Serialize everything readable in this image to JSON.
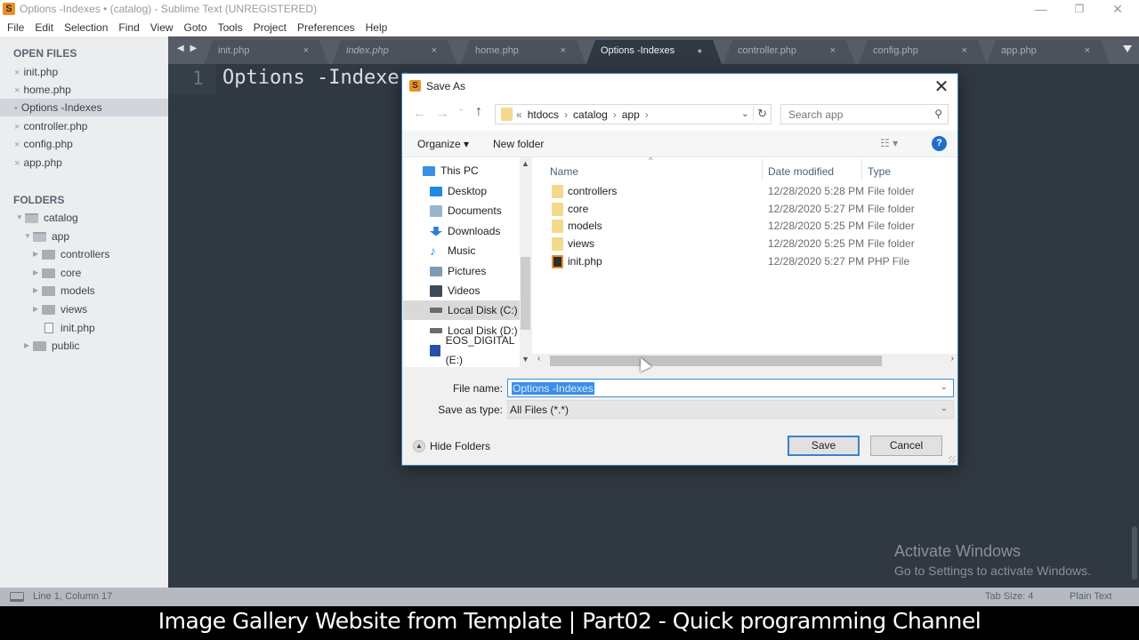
{
  "window": {
    "title": "Options -Indexes • (catalog) - Sublime Text (UNREGISTERED)",
    "controls": {
      "minimize": "—",
      "restore": "❐",
      "close": "✕"
    }
  },
  "menu": [
    "File",
    "Edit",
    "Selection",
    "Find",
    "View",
    "Goto",
    "Tools",
    "Project",
    "Preferences",
    "Help"
  ],
  "sidebar": {
    "open_files_title": "OPEN FILES",
    "open_files": [
      {
        "label": "init.php",
        "marker": "×",
        "active": false
      },
      {
        "label": "home.php",
        "marker": "×",
        "active": false
      },
      {
        "label": "Options -Indexes",
        "marker": "•",
        "active": true
      },
      {
        "label": "controller.php",
        "marker": "×",
        "active": false
      },
      {
        "label": "config.php",
        "marker": "×",
        "active": false
      },
      {
        "label": "app.php",
        "marker": "×",
        "active": false
      }
    ],
    "folders_title": "FOLDERS",
    "tree": [
      {
        "label": "catalog",
        "type": "folder-open",
        "depth": 0
      },
      {
        "label": "app",
        "type": "folder-open",
        "depth": 1
      },
      {
        "label": "controllers",
        "type": "folder",
        "depth": 2
      },
      {
        "label": "core",
        "type": "folder",
        "depth": 2
      },
      {
        "label": "models",
        "type": "folder",
        "depth": 2
      },
      {
        "label": "views",
        "type": "folder",
        "depth": 2
      },
      {
        "label": "init.php",
        "type": "file",
        "depth": 2
      },
      {
        "label": "public",
        "type": "folder",
        "depth": 1
      }
    ]
  },
  "tabs": [
    {
      "label": "init.php",
      "close": "×",
      "active": false,
      "italic": false
    },
    {
      "label": "index.php",
      "close": "×",
      "active": false,
      "italic": true
    },
    {
      "label": "home.php",
      "close": "×",
      "active": false,
      "italic": false
    },
    {
      "label": "Options -Indexes",
      "close": "●",
      "active": true,
      "italic": false
    },
    {
      "label": "controller.php",
      "close": "×",
      "active": false,
      "italic": false
    },
    {
      "label": "config.php",
      "close": "×",
      "active": false,
      "italic": false
    },
    {
      "label": "app.php",
      "close": "×",
      "active": false,
      "italic": false
    }
  ],
  "tab_nav": "◀ ▶",
  "editor": {
    "line_number": "1",
    "code": "Options -Indexes"
  },
  "watermark": {
    "line1": "Activate Windows",
    "line2": "Go to Settings to activate Windows."
  },
  "statusbar": {
    "position": "Line 1, Column 17",
    "tab_size": "Tab Size: 4",
    "syntax": "Plain Text"
  },
  "caption": "Image Gallery Website from Template | Part02 - Quick programming Channel",
  "dialog": {
    "title": "Save As",
    "close": "✕",
    "nav": {
      "back": "←",
      "forward": "→",
      "recent": "⌄",
      "up": "↑"
    },
    "breadcrumb": [
      "«",
      "htdocs",
      "›",
      "catalog",
      "›",
      "app",
      "›"
    ],
    "address_dropdown": "⌄",
    "refresh": "↻",
    "search_placeholder": "Search app",
    "search_icon": "⚲",
    "toolbar": {
      "organize": "Organize ▾",
      "new_folder": "New folder",
      "views": "☷ ▾",
      "help": "?"
    },
    "nav_pane": [
      {
        "label": "This PC",
        "icon": "computer-icon",
        "color": "#3a8ee6",
        "selected": false,
        "indent": 0
      },
      {
        "label": "Desktop",
        "icon": "desktop-icon",
        "color": "#1e88e5",
        "selected": false,
        "indent": 1
      },
      {
        "label": "Documents",
        "icon": "documents-icon",
        "color": "#9bb3cc",
        "selected": false,
        "indent": 1
      },
      {
        "label": "Downloads",
        "icon": "downloads-icon",
        "color": "#2f7fd3",
        "selected": false,
        "indent": 1
      },
      {
        "label": "Music",
        "icon": "music-icon",
        "color": "#2f8fe0",
        "selected": false,
        "indent": 1
      },
      {
        "label": "Pictures",
        "icon": "pictures-icon",
        "color": "#7b9bb8",
        "selected": false,
        "indent": 1
      },
      {
        "label": "Videos",
        "icon": "videos-icon",
        "color": "#3d4a5a",
        "selected": false,
        "indent": 1
      },
      {
        "label": "Local Disk (C:)",
        "icon": "drive-c-icon",
        "color": "#6b6b6b",
        "selected": true,
        "indent": 1
      },
      {
        "label": "Local Disk (D:)",
        "icon": "drive-d-icon",
        "color": "#6b6b6b",
        "selected": false,
        "indent": 1
      },
      {
        "label": "EOS_DIGITAL (E:)",
        "icon": "removable-drive-icon",
        "color": "#2850a8",
        "selected": false,
        "indent": 1
      }
    ],
    "columns": {
      "name": "Name",
      "date": "Date modified",
      "type": "Type"
    },
    "files": [
      {
        "name": "controllers",
        "date": "12/28/2020 5:28 PM",
        "type": "File folder",
        "kind": "folder"
      },
      {
        "name": "core",
        "date": "12/28/2020 5:27 PM",
        "type": "File folder",
        "kind": "folder"
      },
      {
        "name": "models",
        "date": "12/28/2020 5:25 PM",
        "type": "File folder",
        "kind": "folder"
      },
      {
        "name": "views",
        "date": "12/28/2020 5:25 PM",
        "type": "File folder",
        "kind": "folder"
      },
      {
        "name": "init.php",
        "date": "12/28/2020 5:27 PM",
        "type": "PHP File",
        "kind": "php"
      }
    ],
    "file_name_label": "File name:",
    "file_name_value": "Options -Indexes",
    "save_type_label": "Save as type:",
    "save_type_value": "All Files (*.*)",
    "hide_folders": "Hide Folders",
    "save": "Save",
    "cancel": "Cancel"
  }
}
